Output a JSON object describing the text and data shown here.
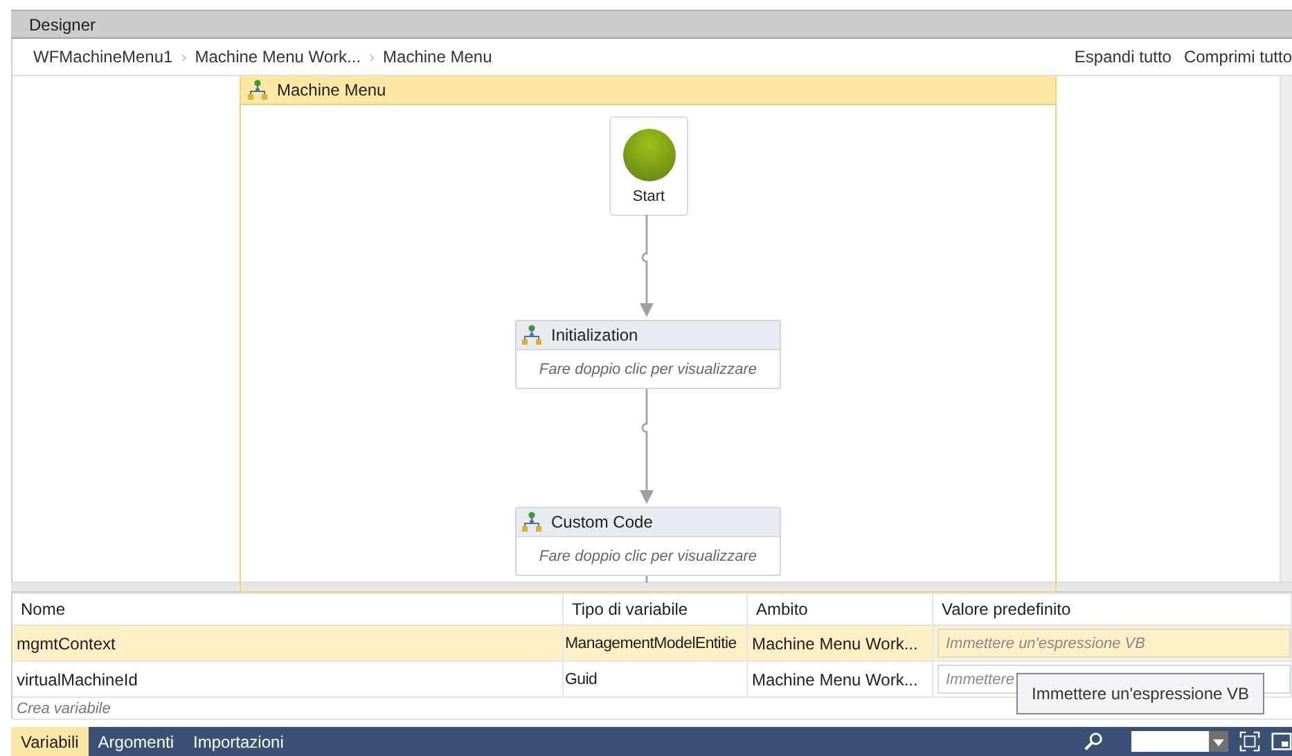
{
  "window": {
    "title": "Designer"
  },
  "breadcrumb": {
    "items": [
      {
        "label": "WFMachineMenu1",
        "separator": "›"
      },
      {
        "label": "Machine Menu Work...",
        "separator": "›"
      },
      {
        "label": "Machine Menu"
      }
    ],
    "actions": [
      "Espandi tutto",
      "Comprimi tutto"
    ]
  },
  "canvas": {
    "container_title": "Machine Menu",
    "start": {
      "label": "Start"
    },
    "activities": [
      {
        "title": "Initialization",
        "hint": "Fare doppio clic per visualizzare"
      },
      {
        "title": "Custom Code",
        "hint": "Fare doppio clic per visualizzare"
      }
    ]
  },
  "variables": {
    "columns": [
      "Nome",
      "Tipo di variabile",
      "Ambito",
      "Valore predefinito"
    ],
    "rows": [
      {
        "name": "mgmtContext",
        "type": "ManagementModelEntitie",
        "scope": "Machine Menu Work...",
        "default_placeholder": "Immettere un'espressione VB",
        "selected": true
      },
      {
        "name": "virtualMachineId",
        "type": "Guid",
        "scope": "Machine Menu Work...",
        "default_placeholder": "Immettere",
        "selected": false
      }
    ],
    "create_hint": "Crea variabile",
    "tooltip": "Immettere un'espressione VB"
  },
  "bottom_tabs": [
    {
      "label": "Variabili",
      "selected": true
    },
    {
      "label": "Argomenti",
      "selected": false
    },
    {
      "label": "Importazioni",
      "selected": false
    }
  ]
}
